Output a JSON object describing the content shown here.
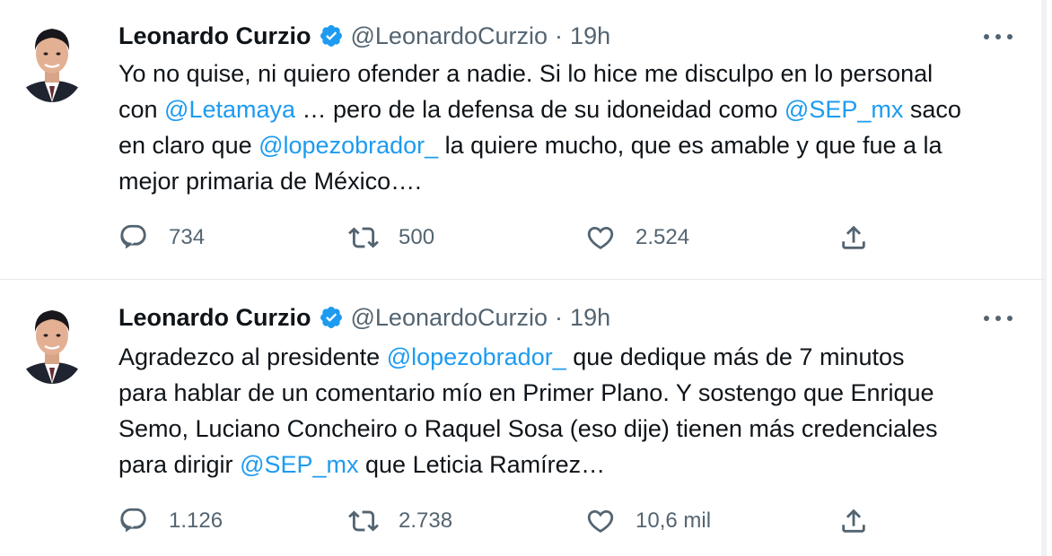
{
  "tweets": [
    {
      "author_name": "Leonardo Curzio",
      "handle": "@LeonardoCurzio",
      "separator": "·",
      "time": "19h",
      "lines": [
        [
          {
            "text": "Yo no quise, ni quiero ofender a nadie. Si lo hice me disculpo en lo personal",
            "mention": false
          }
        ],
        [
          {
            "text": "con ",
            "mention": false
          },
          {
            "text": "@Letamaya",
            "mention": true
          },
          {
            "text": " … pero de la defensa de su idoneidad como ",
            "mention": false
          },
          {
            "text": "@SEP_mx",
            "mention": true
          },
          {
            "text": " saco",
            "mention": false
          }
        ],
        [
          {
            "text": "en claro que ",
            "mention": false
          },
          {
            "text": "@lopezobrador_",
            "mention": true
          },
          {
            "text": " la quiere mucho, que es amable y que fue a la",
            "mention": false
          }
        ],
        [
          {
            "text": "mejor primaria de México….",
            "mention": false
          }
        ]
      ],
      "replies": "734",
      "retweets": "500",
      "likes": "2.524"
    },
    {
      "author_name": "Leonardo Curzio",
      "handle": "@LeonardoCurzio",
      "separator": "·",
      "time": "19h",
      "lines": [
        [
          {
            "text": "Agradezco al presidente ",
            "mention": false
          },
          {
            "text": "@lopezobrador_",
            "mention": true
          },
          {
            "text": " que dedique más de 7 minutos",
            "mention": false
          }
        ],
        [
          {
            "text": "para hablar de un comentario mío en Primer Plano. Y sostengo que Enrique",
            "mention": false
          }
        ],
        [
          {
            "text": "Semo, Luciano Concheiro o Raquel Sosa (eso dije) tienen más credenciales",
            "mention": false
          }
        ],
        [
          {
            "text": "para dirigir ",
            "mention": false
          },
          {
            "text": "@SEP_mx",
            "mention": true
          },
          {
            "text": " que Leticia Ramírez…",
            "mention": false
          }
        ]
      ],
      "replies": "1.126",
      "retweets": "2.738",
      "likes": "10,6 mil"
    }
  ],
  "icons": {
    "verified": "verified-badge-icon",
    "more": "more-options-icon",
    "reply": "reply-icon",
    "retweet": "retweet-icon",
    "like": "like-heart-icon",
    "share": "share-icon"
  },
  "colors": {
    "accent": "#1d9bf0",
    "text": "#0f1419",
    "secondary": "#536471",
    "divider": "#e4e7ea"
  }
}
